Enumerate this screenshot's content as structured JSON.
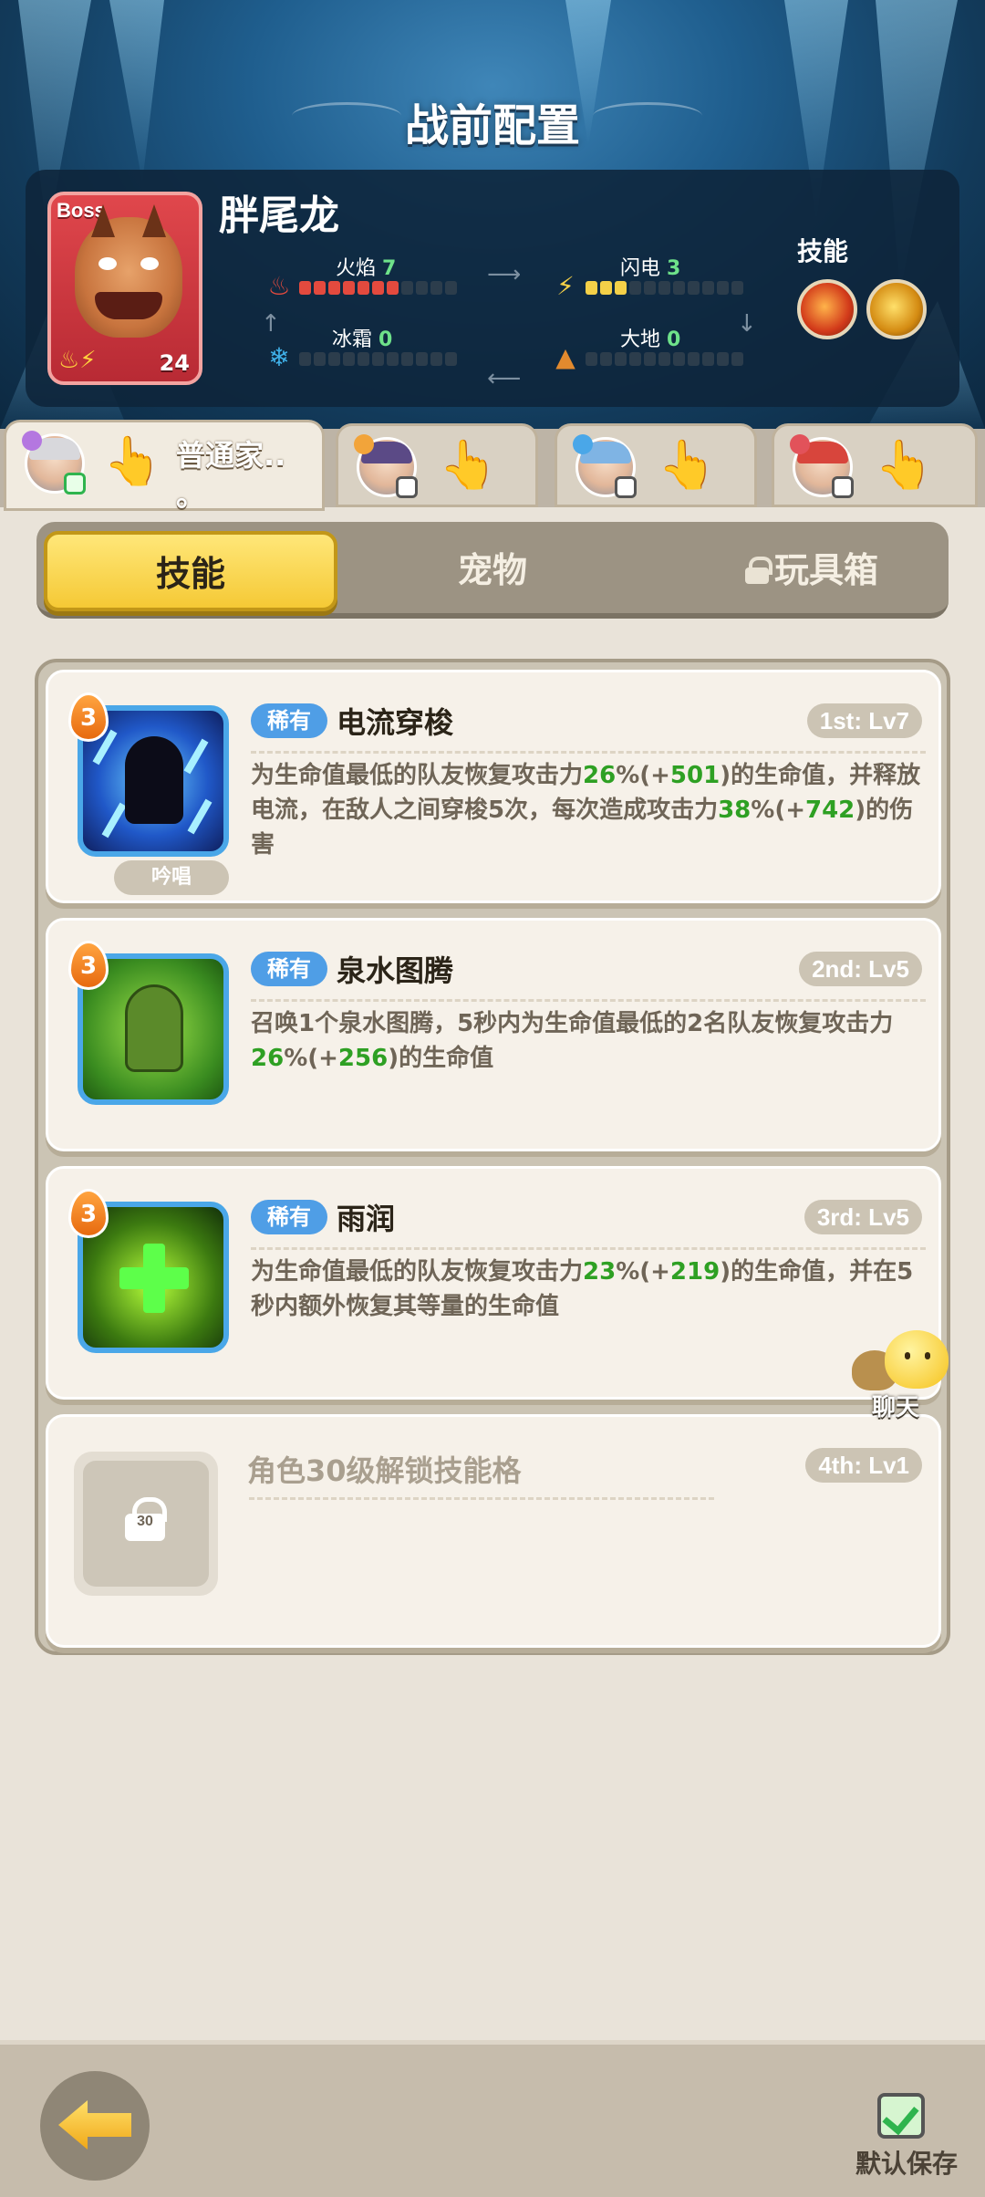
{
  "header": {
    "title": "战前配置"
  },
  "boss": {
    "badge": "Boss",
    "name": "胖尾龙",
    "level": "24",
    "stats": [
      {
        "name": "火焰",
        "value": "7",
        "filled": 7,
        "total": 11,
        "color": "#e34a3e",
        "icon": "flame-icon"
      },
      {
        "name": "闪电",
        "value": "3",
        "filled": 3,
        "total": 11,
        "color": "#f4d048",
        "icon": "lightning-icon"
      },
      {
        "name": "冰霜",
        "value": "0",
        "filled": 0,
        "total": 11,
        "color": "#3fb0e8",
        "icon": "snowflake-icon"
      },
      {
        "name": "大地",
        "value": "0",
        "filled": 0,
        "total": 11,
        "color": "#e28a2e",
        "icon": "earth-icon"
      }
    ],
    "skills_label": "技能"
  },
  "party": {
    "tabs": [
      {
        "label": "普通家.. 。",
        "active": true
      },
      {
        "label": "",
        "active": false
      },
      {
        "label": "",
        "active": false
      },
      {
        "label": "",
        "active": false
      }
    ]
  },
  "segments": {
    "skills": "技能",
    "pets": "宠物",
    "toybox": "玩具箱",
    "active": "skills"
  },
  "skills": [
    {
      "rank": "3",
      "rarity": "稀有",
      "name": "电流穿梭",
      "slot": "1st: Lv7",
      "tag": "吟唱",
      "desc": [
        {
          "t": "为生命值最低的队友恢复攻击力"
        },
        {
          "t": "26",
          "g": true
        },
        {
          "t": "%(+"
        },
        {
          "t": "501",
          "g": true
        },
        {
          "t": ")的生命值，并释放电流，在敌人之间穿梭5次，每次造成攻击力"
        },
        {
          "t": "38",
          "g": true
        },
        {
          "t": "%(+"
        },
        {
          "t": "742",
          "g": true
        },
        {
          "t": ")的伤害"
        }
      ]
    },
    {
      "rank": "3",
      "rarity": "稀有",
      "name": "泉水图腾",
      "slot": "2nd: Lv5",
      "desc": [
        {
          "t": "召唤1个泉水图腾，5秒内为生命值最低的2名队友恢复攻击力"
        },
        {
          "t": "26",
          "g": true
        },
        {
          "t": "%(+"
        },
        {
          "t": "256",
          "g": true
        },
        {
          "t": ")的生命值"
        }
      ]
    },
    {
      "rank": "3",
      "rarity": "稀有",
      "name": "雨润",
      "slot": "3rd: Lv5",
      "desc": [
        {
          "t": "为生命值最低的队友恢复攻击力"
        },
        {
          "t": "23",
          "g": true
        },
        {
          "t": "%(+"
        },
        {
          "t": "219",
          "g": true
        },
        {
          "t": ")的生命值，并在5秒内额外恢复其等量的生命值"
        }
      ]
    }
  ],
  "locked_slot": {
    "title": "角色30级解锁技能格",
    "slot": "4th: Lv1",
    "lock_level": "30"
  },
  "chat": {
    "label": "聊天"
  },
  "footer": {
    "save_label": "默认保存",
    "save_checked": true
  }
}
